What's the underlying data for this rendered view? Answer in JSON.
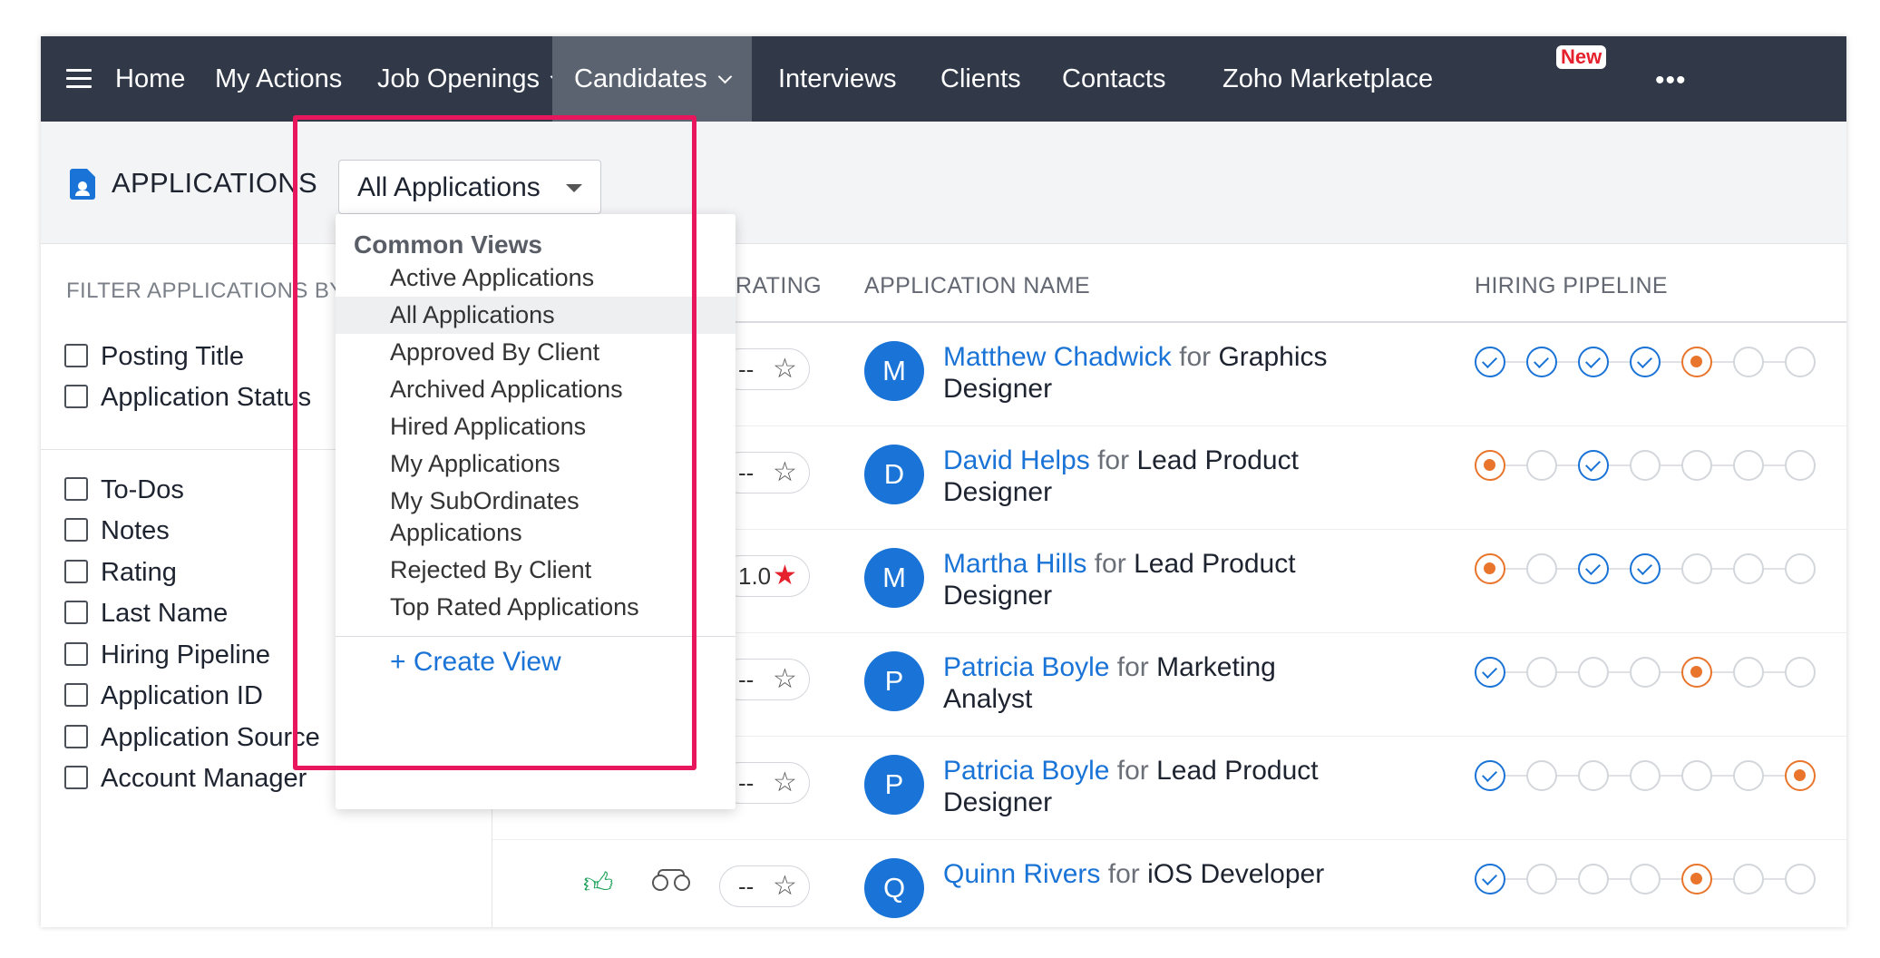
{
  "nav": {
    "items": [
      "Home",
      "My Actions",
      "Job Openings",
      "Candidates",
      "Interviews",
      "Clients",
      "Contacts",
      "Zoho Marketplace"
    ],
    "new_badge": "New",
    "more": "•••",
    "active": "Candidates"
  },
  "header": {
    "title": "APPLICATIONS",
    "view_selected": "All Applications"
  },
  "filter": {
    "title": "FILTER APPLICATIONS BY",
    "top_items": [
      "Posting Title",
      "Application Status"
    ],
    "items": [
      "To-Dos",
      "Notes",
      "Rating",
      "Last Name",
      "Hiring Pipeline",
      "Application ID",
      "Application Source",
      "Account Manager"
    ]
  },
  "table": {
    "col_rating": "RATING",
    "col_name": "APPLICATION NAME",
    "col_pipeline": "HIRING PIPELINE",
    "for_word": "for",
    "rows": [
      {
        "initial": "M",
        "name": "Matthew Chadwick",
        "job": "Graphics Designer",
        "rating": "--",
        "starred": false,
        "pipeline": [
          "done",
          "done",
          "done",
          "done",
          "current",
          "todo",
          "todo"
        ]
      },
      {
        "initial": "D",
        "name": "David Helps",
        "job": "Lead Product Designer",
        "rating": "--",
        "starred": false,
        "pipeline": [
          "current",
          "todo",
          "done",
          "todo",
          "todo",
          "todo",
          "todo"
        ]
      },
      {
        "initial": "M",
        "name": "Martha Hills",
        "job": "Lead Product Designer",
        "rating": "1.0",
        "starred": true,
        "pipeline": [
          "current",
          "todo",
          "done",
          "done",
          "todo",
          "todo",
          "todo"
        ]
      },
      {
        "initial": "P",
        "name": "Patricia Boyle",
        "job": "Marketing Analyst",
        "rating": "--",
        "starred": false,
        "pipeline": [
          "done",
          "todo",
          "todo",
          "todo",
          "current",
          "todo",
          "todo"
        ]
      },
      {
        "initial": "P",
        "name": "Patricia Boyle",
        "job": "Lead Product Designer",
        "rating": "--",
        "starred": false,
        "pipeline": [
          "done",
          "todo",
          "todo",
          "todo",
          "todo",
          "todo",
          "current"
        ]
      },
      {
        "initial": "Q",
        "name": "Quinn Rivers",
        "job": "iOS Developer",
        "rating": "--",
        "starred": false,
        "pipeline": [
          "done",
          "todo",
          "todo",
          "todo",
          "current",
          "todo",
          "todo"
        ]
      }
    ]
  },
  "dropdown": {
    "group_label": "Common Views",
    "items": [
      "Active Applications",
      "All Applications",
      "Approved By Client",
      "Archived Applications",
      "Hired Applications",
      "My Applications",
      "My SubOrdinates Applications",
      "Rejected By Client",
      "Top Rated Applications"
    ],
    "selected": "All Applications",
    "create_label": "+ Create View"
  },
  "colors": {
    "nav_bg": "#313949",
    "accent": "#1a73d6",
    "pipeline_current": "#e8752b",
    "highlight": "#e8175d",
    "star_rated": "#e5212e"
  },
  "icons": {
    "menu": "hamburger-icon",
    "more": "more-dots-icon",
    "page": "document-person-icon",
    "thumb": "thumbs-up-icon",
    "binoculars": "binoculars-icon",
    "star": "star-icon",
    "check": "check-circle-icon"
  }
}
